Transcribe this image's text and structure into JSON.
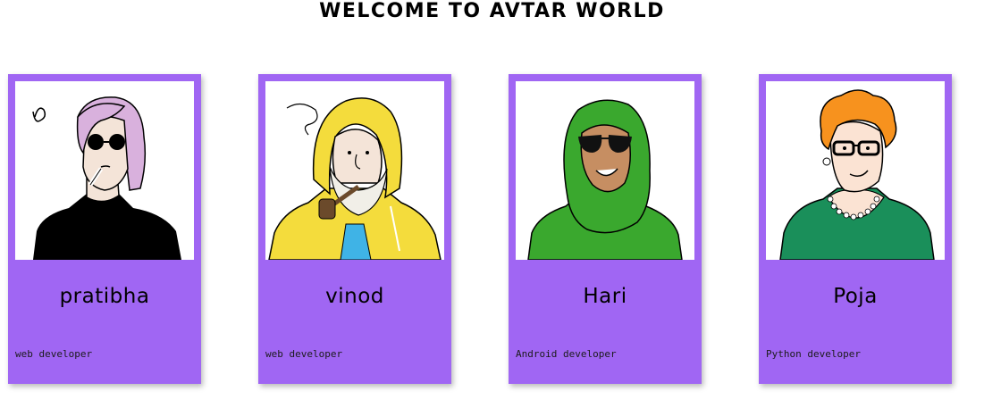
{
  "page": {
    "title": "WELCOME TO AVTAR WORLD"
  },
  "cards": [
    {
      "name": "pratibha",
      "role": "web developer",
      "avatar_icon": "woman-sunglasses-cigarette-icon"
    },
    {
      "name": "vinod",
      "role": "web developer",
      "avatar_icon": "fisherman-pipe-raincoat-icon"
    },
    {
      "name": "Hari",
      "role": "Android developer",
      "avatar_icon": "woman-hijab-sunglasses-icon"
    },
    {
      "name": "Poja",
      "role": "Python developer",
      "avatar_icon": "woman-glasses-pearls-icon"
    }
  ],
  "colors": {
    "card_background": "#a066f3",
    "page_background": "#ffffff"
  }
}
